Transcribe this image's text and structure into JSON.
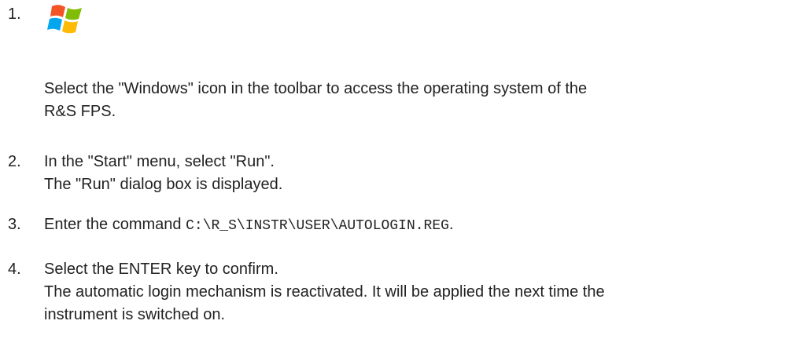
{
  "steps": [
    {
      "number": "1.",
      "icon": "windows-logo-icon",
      "lines": [
        "Select the \"Windows\" icon in the toolbar to access the operating system of the",
        "R&S FPS."
      ]
    },
    {
      "number": "2.",
      "lines": [
        "In the \"Start\" menu, select \"Run\".",
        "The \"Run\" dialog box is displayed."
      ]
    },
    {
      "number": "3.",
      "text_before": "Enter the command ",
      "code": "C:\\R_S\\INSTR\\USER\\AUTOLOGIN.REG",
      "text_after": "."
    },
    {
      "number": "4.",
      "lines": [
        "Select the ENTER key to confirm.",
        "The automatic login mechanism is reactivated. It will be applied the next time the",
        "instrument is switched on."
      ]
    }
  ],
  "colors": {
    "text": "#222222",
    "logo_red": "#f35325",
    "logo_green": "#81bc06",
    "logo_blue": "#05a6f0",
    "logo_yellow": "#ffba08"
  }
}
